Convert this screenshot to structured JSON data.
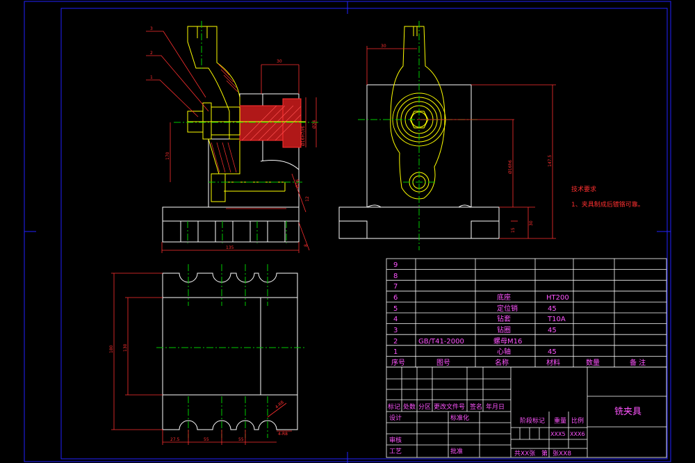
{
  "colors": {
    "background": "#000000",
    "frame": "#2222ff",
    "part_outline": "#ffff00",
    "hatch_red": "#ff3030",
    "center_line": "#00cc00",
    "dimension": "#ff3030",
    "leader": "#ff3030",
    "body_outline": "#ffffff",
    "table_text": "#ff55ff",
    "table_lines": "#ffffff"
  },
  "views": {
    "front_balloons": [
      "3",
      "2",
      "1"
    ],
    "front_dims": [
      "30",
      "Ø16H7/r6",
      "Ø24",
      "Ø16",
      "170",
      "135",
      "12",
      "8"
    ],
    "side_dims": [
      "30",
      "Ø16h6",
      "147.5",
      "30",
      "15"
    ],
    "top_dims": [
      "180",
      "130",
      "27.5",
      "55",
      "55",
      "4-R8",
      "4-R8"
    ]
  },
  "tech_requirements": {
    "title": "技术要求",
    "items": [
      "1、夹具制成后镀铬可靠。"
    ]
  },
  "parts_list": {
    "rows": [
      {
        "no": "9",
        "drawing": "",
        "name": "",
        "material": "",
        "qty": "",
        "note": ""
      },
      {
        "no": "8",
        "drawing": "",
        "name": "",
        "material": "",
        "qty": "",
        "note": ""
      },
      {
        "no": "7",
        "drawing": "",
        "name": "",
        "material": "",
        "qty": "",
        "note": ""
      },
      {
        "no": "6",
        "drawing": "",
        "name": "底座",
        "material": "HT200",
        "qty": "",
        "note": ""
      },
      {
        "no": "5",
        "drawing": "",
        "name": "定位销",
        "material": "45",
        "qty": "",
        "note": ""
      },
      {
        "no": "4",
        "drawing": "",
        "name": "钻套",
        "material": "T10A",
        "qty": "",
        "note": ""
      },
      {
        "no": "3",
        "drawing": "",
        "name": "钻圈",
        "material": "45",
        "qty": "",
        "note": ""
      },
      {
        "no": "2",
        "drawing": "GB/T41-2000",
        "name": "螺母M16",
        "material": "",
        "qty": "",
        "note": ""
      },
      {
        "no": "1",
        "drawing": "",
        "name": "心轴",
        "material": "45",
        "qty": "",
        "note": ""
      }
    ],
    "header": {
      "no": "序号",
      "drawing": "图号",
      "name": "名称",
      "material": "材料",
      "qty": "数量",
      "note": "备 注"
    }
  },
  "title_block": {
    "title": "铣夹具",
    "rev_labels": [
      "标记",
      "处数",
      "分区",
      "更改文件号",
      "签名",
      "年月日"
    ],
    "design": "设计",
    "standardize": "标准化",
    "review": "审核",
    "process": "工艺",
    "approve": "批准",
    "stage_label": "阶段标记",
    "weight_label": "重量",
    "scale_label": "比例",
    "weight_value": "XXX5",
    "scale_value": "XXX6",
    "sheets_total": "共XX张",
    "sheet_no_label": "第",
    "sheet_no": "张XX8"
  }
}
